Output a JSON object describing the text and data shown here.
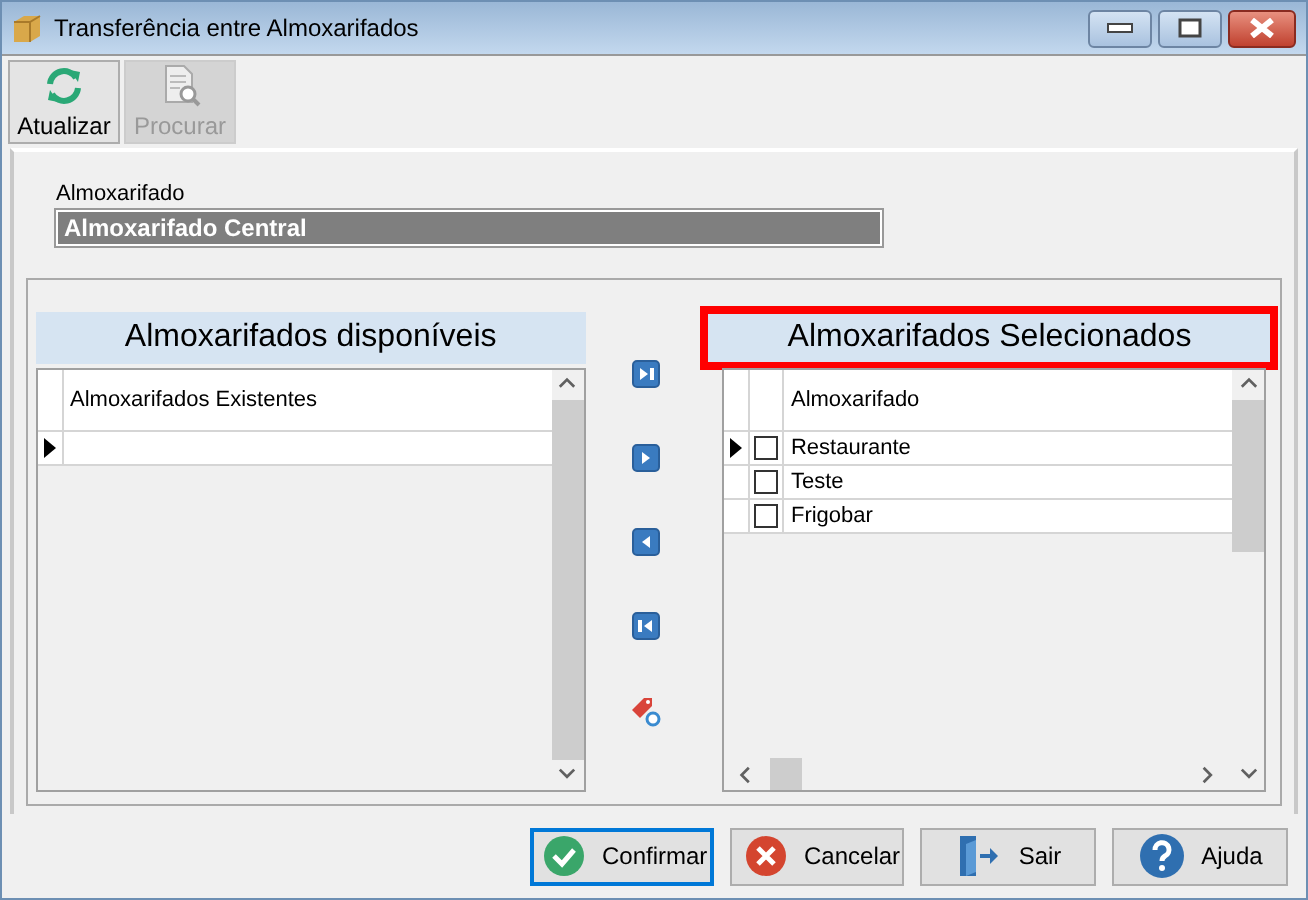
{
  "window": {
    "title": "Transferência entre Almoxarifados"
  },
  "toolbar": [
    {
      "label": "Atualizar",
      "kind": "refresh",
      "disabled": false
    },
    {
      "label": "Procurar",
      "kind": "search",
      "disabled": true
    }
  ],
  "field": {
    "label": "Almoxarifado",
    "value": "Almoxarifado Central"
  },
  "available": {
    "title": "Almoxarifados disponíveis",
    "highlighted": false,
    "column": "Almoxarifados Existentes",
    "rows": [
      {
        "current": true
      }
    ]
  },
  "transfer_buttons": [
    {
      "kind": "move-all-right"
    },
    {
      "kind": "move-right"
    },
    {
      "kind": "move-left"
    },
    {
      "kind": "move-all-left"
    },
    {
      "kind": "clear"
    }
  ],
  "selected": {
    "title": "Almoxarifados Selecionados",
    "highlighted": true,
    "column": "Almoxarifado",
    "rows": [
      {
        "name": "Restaurante",
        "checked": false,
        "current": true
      },
      {
        "name": "Teste",
        "checked": false,
        "current": false
      },
      {
        "name": "Frigobar",
        "checked": false,
        "current": false
      }
    ]
  },
  "buttons": [
    {
      "label": "Confirmar",
      "kind": "confirm",
      "focused": true
    },
    {
      "label": "Cancelar",
      "kind": "cancel",
      "focused": false
    },
    {
      "label": "Sair",
      "kind": "exit",
      "focused": false
    },
    {
      "label": "Ajuda",
      "kind": "help",
      "focused": false
    }
  ]
}
